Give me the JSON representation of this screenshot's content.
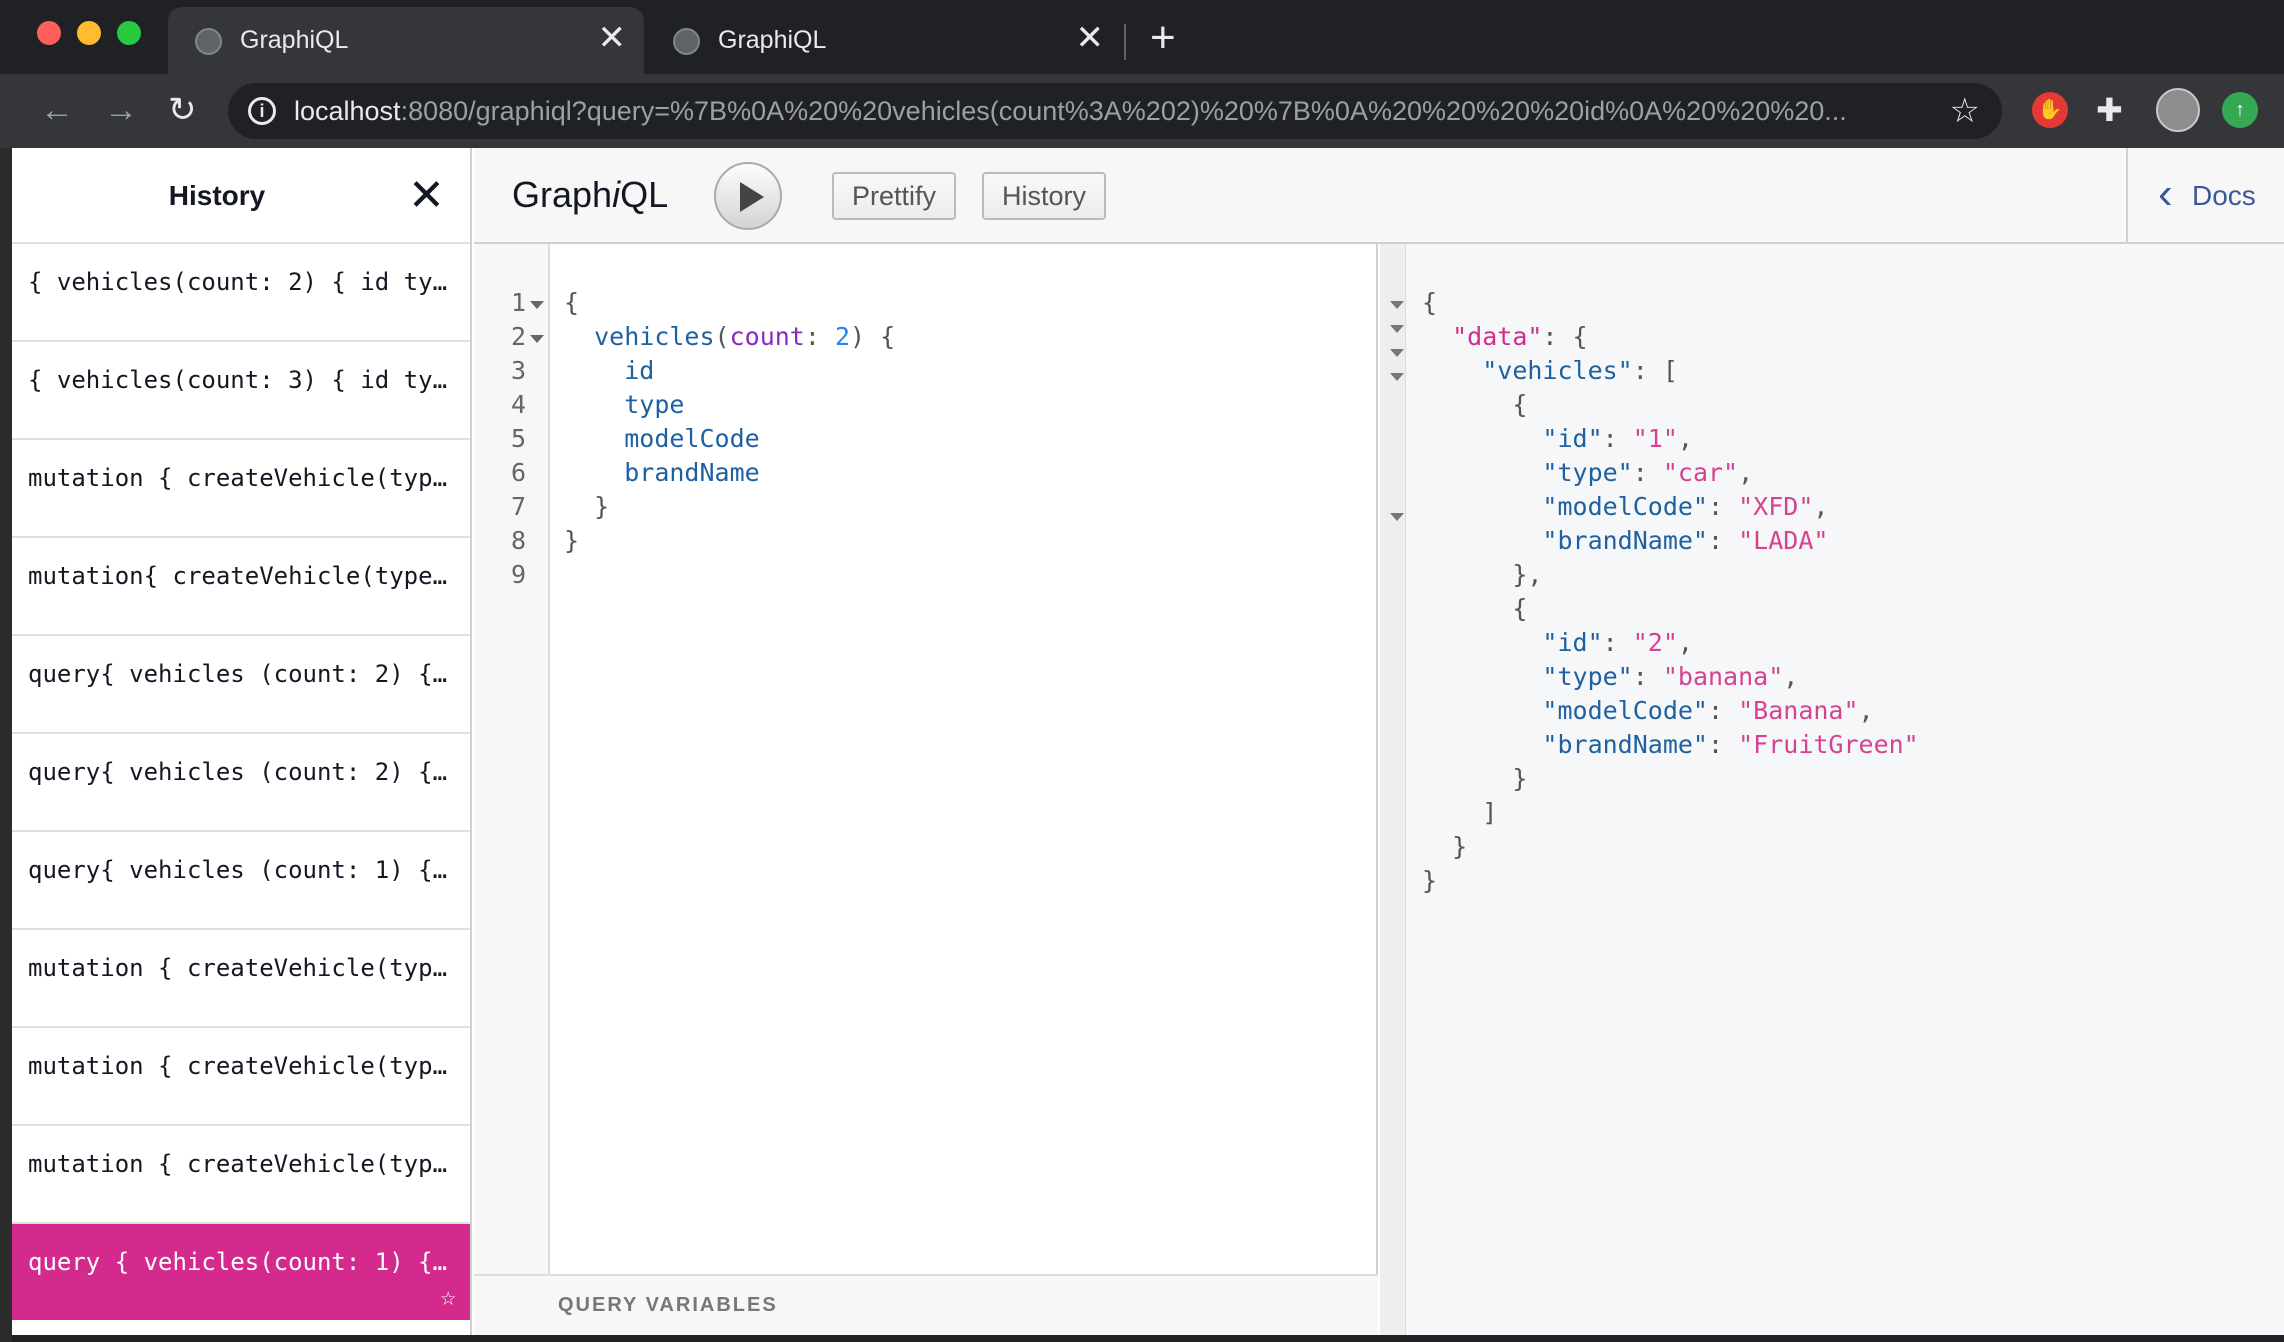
{
  "browser": {
    "tabs": [
      {
        "title": "GraphiQL",
        "active": true
      },
      {
        "title": "GraphiQL",
        "active": false
      }
    ],
    "url_host": "localhost",
    "url_rest": ":8080/graphiql?query=%7B%0A%20%20vehicles(count%3A%202)%20%7B%0A%20%20%20%20id%0A%20%20%20..."
  },
  "history_panel": {
    "title": "History",
    "items": [
      "{ vehicles(count: 2) { id ty…",
      "{ vehicles(count: 3) { id ty…",
      "mutation { createVehicle(typ…",
      "mutation{ createVehicle(type…",
      "query{ vehicles (count: 2) {…",
      "query{ vehicles (count: 2) {…",
      "query{ vehicles (count: 1) {…",
      "mutation { createVehicle(typ…",
      "mutation { createVehicle(typ…",
      "mutation { createVehicle(typ…",
      "query { vehicles(count: 1) {…"
    ],
    "selected_index": 10
  },
  "toolbar": {
    "logo_prefix": "Graph",
    "logo_i": "i",
    "logo_suffix": "QL",
    "prettify_label": "Prettify",
    "history_label": "History",
    "docs_label": "Docs"
  },
  "editor": {
    "line_numbers": [
      "1",
      "2",
      "3",
      "4",
      "5",
      "6",
      "7",
      "8",
      "9"
    ],
    "lines": {
      "l1": "{",
      "l2_field": "vehicles",
      "l2_paren_open": "(",
      "l2_arg": "count",
      "l2_colon": ": ",
      "l2_value": "2",
      "l2_tail": ") {",
      "l3": "id",
      "l4": "type",
      "l5": "modelCode",
      "l6": "brandName",
      "l7": "}",
      "l8": "}",
      "l9": ""
    },
    "variables_label": "QUERY VARIABLES"
  },
  "result": {
    "lines": [
      {
        "indent": 0,
        "parts": [
          [
            "p",
            "{"
          ]
        ]
      },
      {
        "indent": 1,
        "parts": [
          [
            "kr",
            "\"data\""
          ],
          [
            "p",
            ": {"
          ]
        ]
      },
      {
        "indent": 2,
        "parts": [
          [
            "k",
            "\"vehicles\""
          ],
          [
            "p",
            ": ["
          ]
        ]
      },
      {
        "indent": 3,
        "parts": [
          [
            "p",
            "{"
          ]
        ]
      },
      {
        "indent": 4,
        "parts": [
          [
            "k",
            "\"id\""
          ],
          [
            "p",
            ": "
          ],
          [
            "s",
            "\"1\""
          ],
          [
            "p",
            ","
          ]
        ]
      },
      {
        "indent": 4,
        "parts": [
          [
            "k",
            "\"type\""
          ],
          [
            "p",
            ": "
          ],
          [
            "s",
            "\"car\""
          ],
          [
            "p",
            ","
          ]
        ]
      },
      {
        "indent": 4,
        "parts": [
          [
            "k",
            "\"modelCode\""
          ],
          [
            "p",
            ": "
          ],
          [
            "s",
            "\"XFD\""
          ],
          [
            "p",
            ","
          ]
        ]
      },
      {
        "indent": 4,
        "parts": [
          [
            "k",
            "\"brandName\""
          ],
          [
            "p",
            ": "
          ],
          [
            "s",
            "\"LADA\""
          ]
        ]
      },
      {
        "indent": 3,
        "parts": [
          [
            "p",
            "},"
          ]
        ]
      },
      {
        "indent": 3,
        "parts": [
          [
            "p",
            "{"
          ]
        ]
      },
      {
        "indent": 4,
        "parts": [
          [
            "k",
            "\"id\""
          ],
          [
            "p",
            ": "
          ],
          [
            "s",
            "\"2\""
          ],
          [
            "p",
            ","
          ]
        ]
      },
      {
        "indent": 4,
        "parts": [
          [
            "k",
            "\"type\""
          ],
          [
            "p",
            ": "
          ],
          [
            "s",
            "\"banana\""
          ],
          [
            "p",
            ","
          ]
        ]
      },
      {
        "indent": 4,
        "parts": [
          [
            "k",
            "\"modelCode\""
          ],
          [
            "p",
            ": "
          ],
          [
            "s",
            "\"Banana\""
          ],
          [
            "p",
            ","
          ]
        ]
      },
      {
        "indent": 4,
        "parts": [
          [
            "k",
            "\"brandName\""
          ],
          [
            "p",
            ": "
          ],
          [
            "s",
            "\"FruitGreen\""
          ]
        ]
      },
      {
        "indent": 3,
        "parts": [
          [
            "p",
            "}"
          ]
        ]
      },
      {
        "indent": 2,
        "parts": [
          [
            "p",
            "]"
          ]
        ]
      },
      {
        "indent": 1,
        "parts": [
          [
            "p",
            "}"
          ]
        ]
      },
      {
        "indent": 0,
        "parts": [
          [
            "p",
            "}"
          ]
        ]
      }
    ]
  },
  "colors": {
    "history_selected": "#d42a8e",
    "string": "#d64292",
    "key": "#1f61a0",
    "attribute": "#8b2bb9",
    "number": "#2882f9"
  },
  "icons": [
    "globe-icon",
    "close-icon",
    "plus-icon",
    "back-icon",
    "forward-icon",
    "reload-icon",
    "info-icon",
    "star-icon",
    "adblock-icon",
    "extensions-icon",
    "avatar",
    "update-icon",
    "play-icon",
    "chevron-left-icon"
  ]
}
